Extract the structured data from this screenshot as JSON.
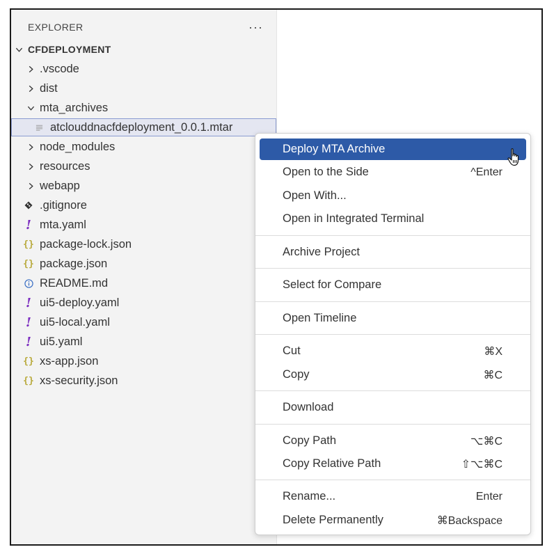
{
  "explorer": {
    "title": "EXPLORER",
    "more_label": "···",
    "root": "CFDEPLOYMENT",
    "items": [
      {
        "label": ".vscode",
        "kind": "folder",
        "expanded": false
      },
      {
        "label": "dist",
        "kind": "folder",
        "expanded": false
      },
      {
        "label": "mta_archives",
        "kind": "folder",
        "expanded": true
      },
      {
        "label": "atclouddnacfdeployment_0.0.1.mtar",
        "kind": "file",
        "icon": "lines-icon",
        "selected": true
      },
      {
        "label": "node_modules",
        "kind": "folder",
        "expanded": false
      },
      {
        "label": "resources",
        "kind": "folder",
        "expanded": false
      },
      {
        "label": "webapp",
        "kind": "folder",
        "expanded": false
      },
      {
        "label": ".gitignore",
        "kind": "file",
        "icon": "git-icon"
      },
      {
        "label": "mta.yaml",
        "kind": "file",
        "icon": "yaml-icon"
      },
      {
        "label": "package-lock.json",
        "kind": "file",
        "icon": "json-icon"
      },
      {
        "label": "package.json",
        "kind": "file",
        "icon": "json-icon"
      },
      {
        "label": "README.md",
        "kind": "file",
        "icon": "info-icon"
      },
      {
        "label": "ui5-deploy.yaml",
        "kind": "file",
        "icon": "yaml-icon"
      },
      {
        "label": "ui5-local.yaml",
        "kind": "file",
        "icon": "yaml-icon"
      },
      {
        "label": "ui5.yaml",
        "kind": "file",
        "icon": "yaml-icon"
      },
      {
        "label": "xs-app.json",
        "kind": "file",
        "icon": "json-icon"
      },
      {
        "label": "xs-security.json",
        "kind": "file",
        "icon": "json-icon"
      }
    ]
  },
  "context_menu": {
    "items": [
      {
        "label": "Deploy MTA Archive",
        "shortcut": "",
        "active": true
      },
      {
        "label": "Open to the Side",
        "shortcut": "^Enter"
      },
      {
        "label": "Open With...",
        "shortcut": ""
      },
      {
        "label": "Open in Integrated Terminal",
        "shortcut": ""
      },
      {
        "label": "Archive Project",
        "shortcut": ""
      },
      {
        "label": "Select for Compare",
        "shortcut": ""
      },
      {
        "label": "Open Timeline",
        "shortcut": ""
      },
      {
        "label": "Cut",
        "shortcut": "⌘X"
      },
      {
        "label": "Copy",
        "shortcut": "⌘C"
      },
      {
        "label": "Download",
        "shortcut": ""
      },
      {
        "label": "Copy Path",
        "shortcut": "⌥⌘C"
      },
      {
        "label": "Copy Relative Path",
        "shortcut": "⇧⌥⌘C"
      },
      {
        "label": "Rename...",
        "shortcut": "Enter"
      },
      {
        "label": "Delete Permanently",
        "shortcut": "⌘Backspace"
      }
    ]
  },
  "colors": {
    "active_menu_bg": "#2d5aa7",
    "selected_row_bg": "#e4e6f1",
    "selected_row_border": "#8a9bd1",
    "json_icon": "#b8a93a",
    "yaml_icon": "#7a2bbf",
    "info_icon": "#3a6fc4"
  }
}
